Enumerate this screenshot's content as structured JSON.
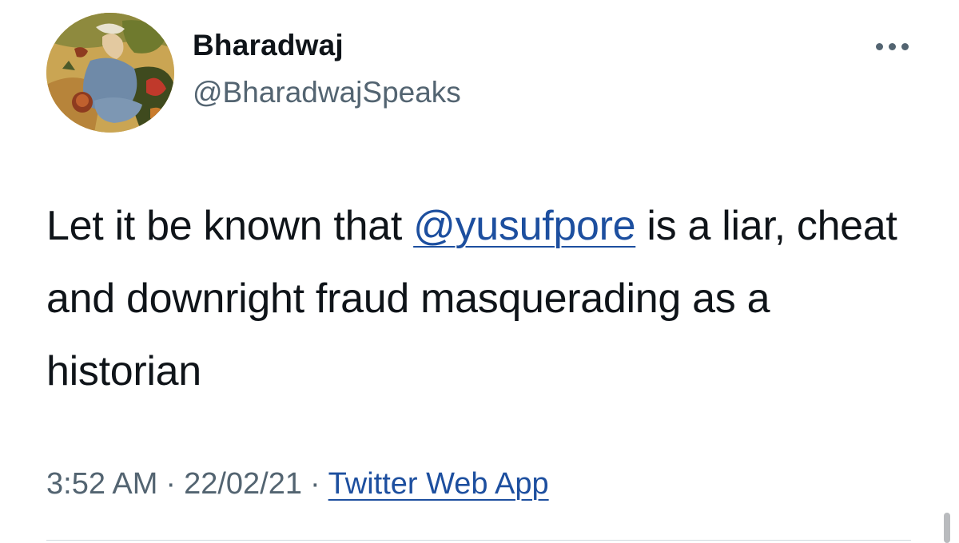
{
  "author": {
    "display_name": "Bharadwaj",
    "handle": "@BharadwajSpeaks",
    "avatar_icon": "miniature-painting-avatar"
  },
  "more_icon": "more-options-icon",
  "tweet": {
    "text_before": "Let it be known that ",
    "mention": "@yusufpore",
    "text_after": " is a liar, cheat and downright fraud masquerading as a historian"
  },
  "meta": {
    "time": "3:52 AM",
    "separator": "·",
    "date": "22/02/21",
    "source": "Twitter Web App"
  },
  "colors": {
    "link": "#1d4f9f",
    "text": "#0f1419",
    "secondary": "#536471"
  }
}
